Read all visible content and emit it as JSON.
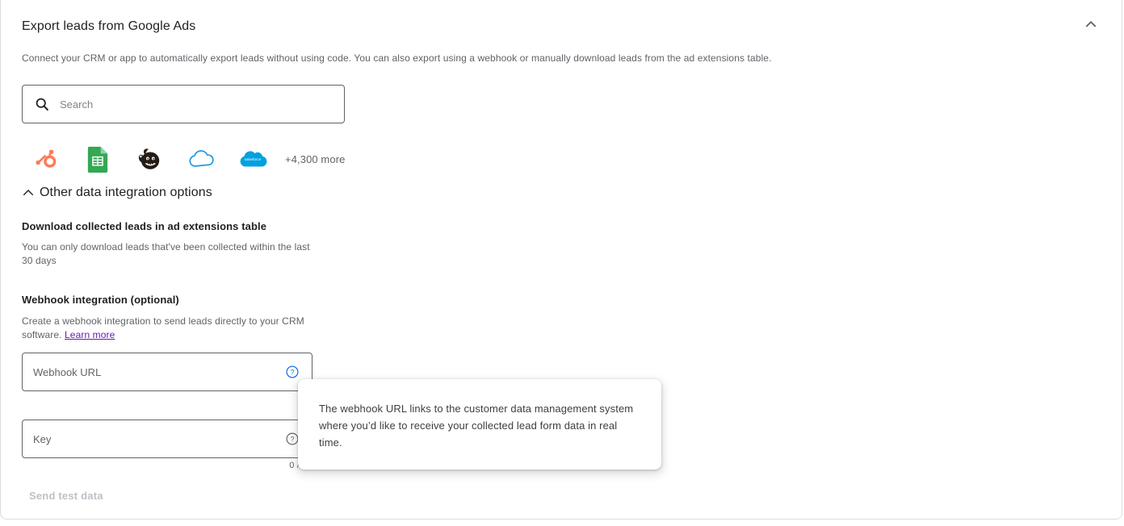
{
  "card": {
    "title": "Export leads from Google Ads",
    "description": "Connect your CRM or app to automatically export leads without using code. You can also export using a webhook or manually download leads from the ad extensions table.",
    "collapse_icon": "chevron-up-icon"
  },
  "search": {
    "placeholder": "Search",
    "value": "",
    "icon": "search-icon"
  },
  "integrations": {
    "logos": [
      {
        "name": "hubspot-logo",
        "label": "HubSpot",
        "color": "#FF7A59"
      },
      {
        "name": "google-sheets-logo",
        "label": "Google Sheets",
        "color": "#34A853"
      },
      {
        "name": "mailchimp-logo",
        "label": "Mailchimp",
        "color": "#241C15"
      },
      {
        "name": "cloud-logo",
        "label": "Cloud integration",
        "color": "#1A9AE8"
      },
      {
        "name": "salesforce-logo",
        "label": "Salesforce",
        "color": "#00A1E0"
      }
    ],
    "more_label": "+4,300 more"
  },
  "other_options": {
    "toggle_label": "Other data integration options",
    "toggle_icon": "chevron-up-icon",
    "download": {
      "title": "Download collected leads in ad extensions table",
      "body": "You can only download leads that've been collected within the last 30 days"
    },
    "webhook": {
      "title": "Webhook integration (optional)",
      "body_prefix": "Create a webhook integration to send leads directly to your CRM software. ",
      "link_label": "Learn more",
      "url_field": {
        "placeholder": "Webhook URL",
        "value": "",
        "help_icon": "help-circle-icon",
        "help_icon_color": "#1a73e8"
      },
      "key_field": {
        "placeholder": "Key",
        "value": "",
        "help_icon": "help-circle-icon",
        "help_icon_color": "#5f6368",
        "counter": "0 / 50"
      },
      "send_test_label": "Send test data"
    }
  },
  "tooltip": {
    "text": "The webhook URL links to the customer data management system where you’d like to receive your collected lead form data in real time."
  }
}
